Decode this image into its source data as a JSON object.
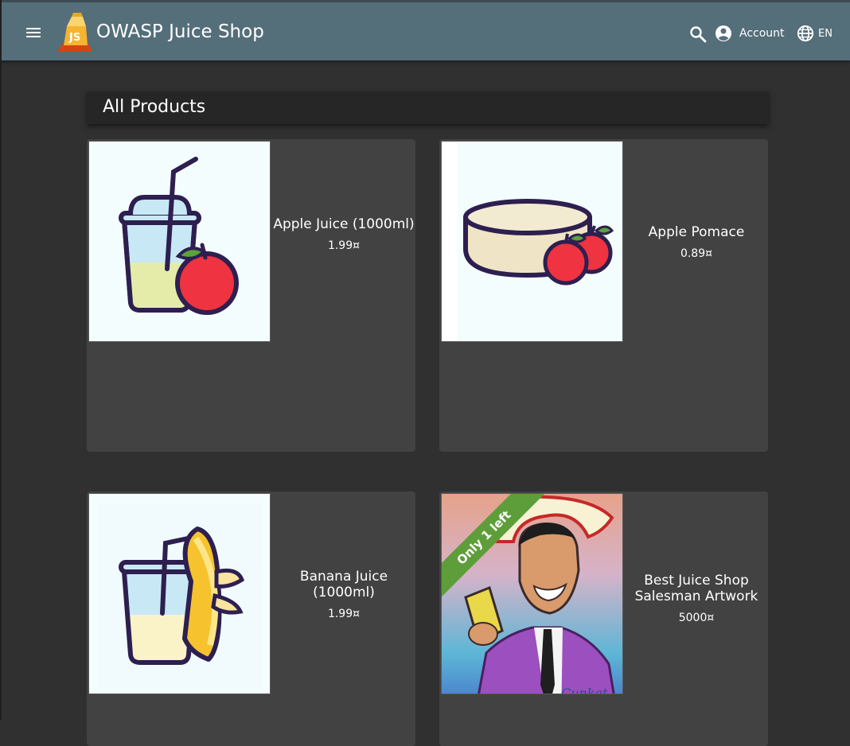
{
  "header": {
    "app_title": "OWASP Juice Shop",
    "account_label": "Account",
    "language_label": "EN",
    "menu_icon": "menu-icon",
    "search_icon": "search-icon",
    "account_icon": "account-circle-icon",
    "language_icon": "globe-icon",
    "bar_color": "#546e7a"
  },
  "main": {
    "heading": "All Products",
    "products": [
      {
        "name": "Apple Juice (1000ml)",
        "price": "1.99¤",
        "image": "apple-juice-image"
      },
      {
        "name": "Apple Pomace",
        "price": "0.89¤",
        "image": "apple-pomace-image"
      },
      {
        "name": "Banana Juice (1000ml)",
        "price": "1.99¤",
        "image": "banana-juice-image"
      },
      {
        "name": "Best Juice Shop Salesman Artwork",
        "price": "5000¤",
        "image": "salesman-artwork-image",
        "ribbon": "Only 1 left"
      }
    ]
  },
  "colors": {
    "background": "#303030",
    "card": "#424242",
    "ribbon": "#5e9e3a"
  }
}
